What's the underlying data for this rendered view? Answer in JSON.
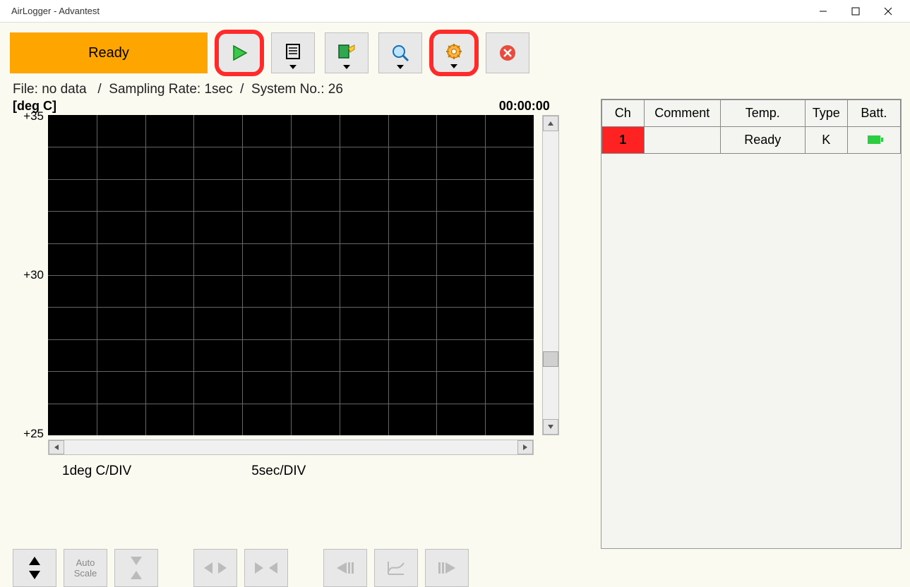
{
  "window": {
    "title": "AirLogger - Advantest"
  },
  "status": {
    "label": "Ready"
  },
  "info": {
    "file_label": "File:",
    "file_value": "no data",
    "sampling_label": "Sampling Rate:",
    "sampling_value": "1sec",
    "system_label": "System No.:",
    "system_value": "26"
  },
  "chart": {
    "y_unit": "[deg C]",
    "time": "00:00:00",
    "y_ticks": [
      "+35",
      "+30",
      "+25"
    ],
    "y_div": "1deg C/DIV",
    "x_div": "5sec/DIV"
  },
  "controls": {
    "autoscale": "Auto\nScale"
  },
  "table": {
    "headers": [
      "Ch",
      "Comment",
      "Temp.",
      "Type",
      "Batt."
    ],
    "rows": [
      {
        "ch": "1",
        "comment": "",
        "temp": "Ready",
        "type": "K"
      }
    ]
  },
  "chart_data": {
    "type": "line",
    "title": "",
    "xlabel": "time",
    "ylabel": "deg C",
    "ylim": [
      25,
      35
    ],
    "x_div_seconds": 5,
    "y_div_deg": 1,
    "series": []
  }
}
